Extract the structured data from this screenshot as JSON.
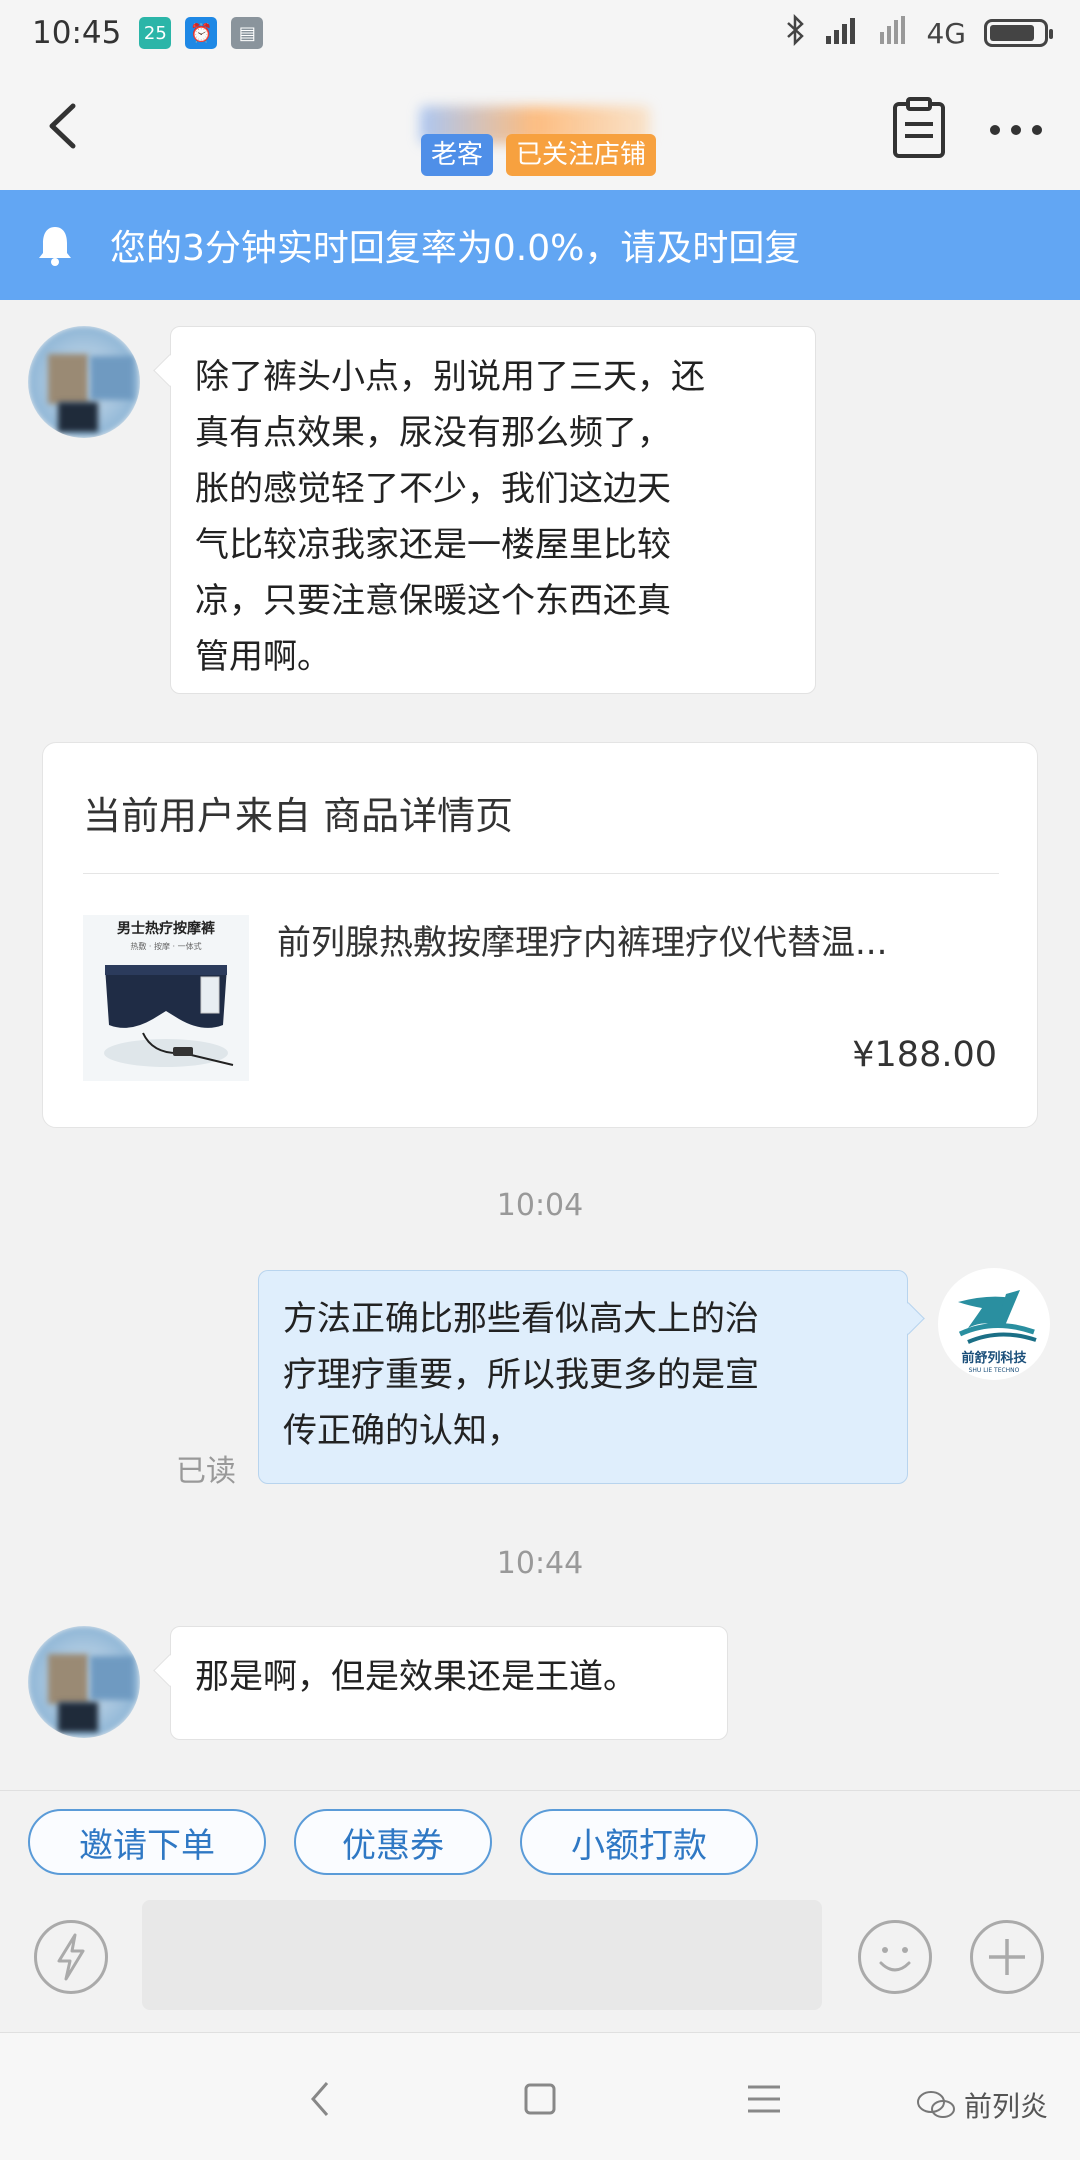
{
  "status_bar": {
    "time": "10:45",
    "notif_badge": "25",
    "network": "4G"
  },
  "header": {
    "badge_old_customer": "老客",
    "badge_following": "已关注店铺"
  },
  "notice": {
    "text": "您的3分钟实时回复率为0.0%，请及时回复"
  },
  "messages": {
    "m1": {
      "lines": [
        "除了裤头小点，别说用了三天，还",
        "真有点效果，尿没有那么频了，",
        "胀的感觉轻了不少，我们这边天",
        "气比较凉我家还是一楼屋里比较",
        "凉，只要注意保暖这个东西还真",
        "管用啊。"
      ]
    },
    "time1": "10:04",
    "m2": {
      "lines": [
        "方法正确比那些看似高大上的治",
        "疗理疗重要，所以我更多的是宣",
        "传正确的认知，"
      ],
      "read_status": "已读"
    },
    "time2": "10:44",
    "m3": {
      "text": "那是啊，但是效果还是王道。"
    }
  },
  "product_card": {
    "source": "当前用户来自 商品详情页",
    "title": "前列腺热敷按摩理疗内裤理疗仪代替温...",
    "price": "¥188.00",
    "thumb_caption": "男士热疗按摩裤",
    "thumb_sub": "热敷 · 按摩 · 一体式"
  },
  "shop_logo": {
    "name": "前舒列科技",
    "sub": "SHU LIE TECHNO"
  },
  "quick_actions": [
    "邀请下单",
    "优惠券",
    "小额打款"
  ],
  "input": {
    "placeholder": ""
  },
  "watermark": "前列炎",
  "colors": {
    "notice_bg": "#62a6f3",
    "chip_border": "#5a9bd8",
    "bubble_self": "#dfeefc"
  }
}
